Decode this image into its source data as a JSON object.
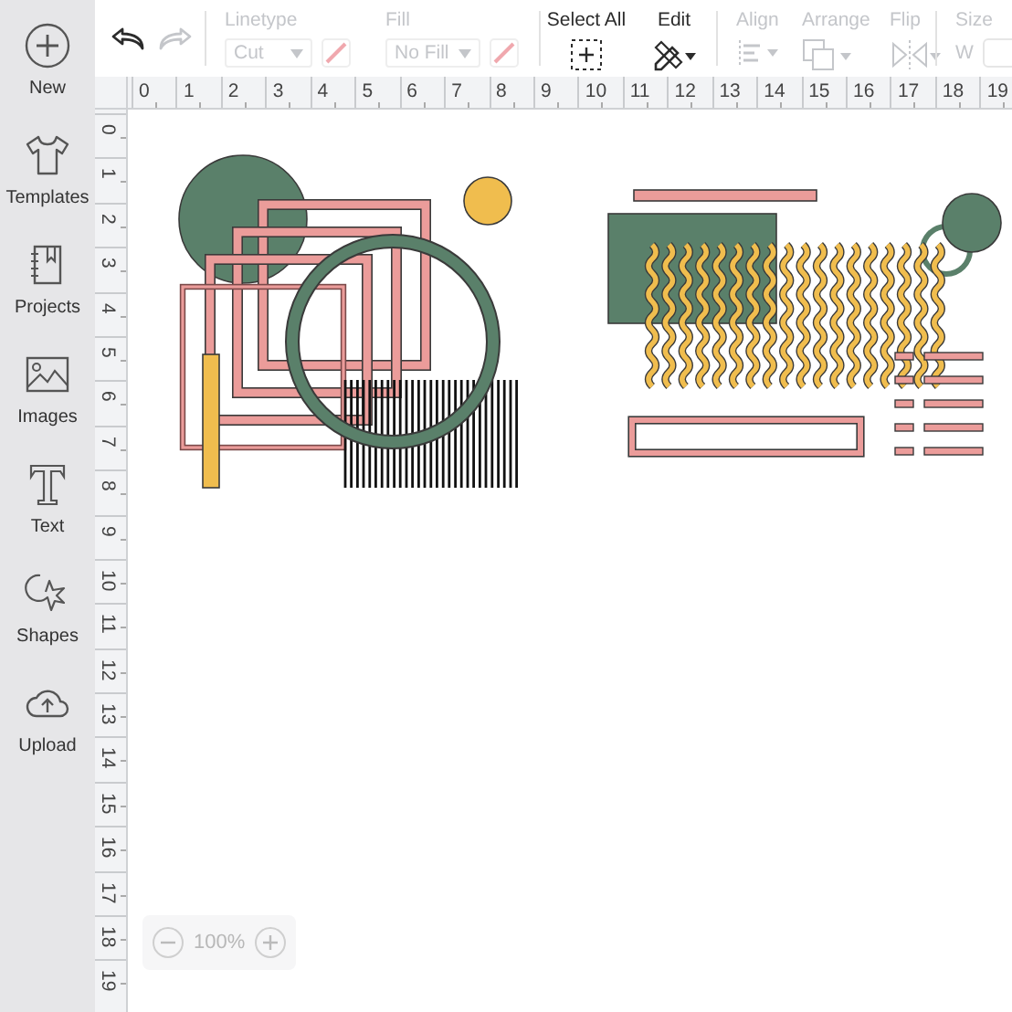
{
  "sidebar": {
    "items": [
      {
        "kind": "new",
        "label": "New"
      },
      {
        "kind": "templates",
        "label": "Templates"
      },
      {
        "kind": "projects",
        "label": "Projects"
      },
      {
        "kind": "images",
        "label": "Images"
      },
      {
        "kind": "text",
        "label": "Text"
      },
      {
        "kind": "shapes",
        "label": "Shapes"
      },
      {
        "kind": "upload",
        "label": "Upload"
      }
    ]
  },
  "toolbar": {
    "undo": {
      "disabled": false
    },
    "redo": {
      "disabled": true
    },
    "groups": [
      {
        "kind": "linetype",
        "label": "Linetype",
        "value": "Cut",
        "disabled": true
      },
      {
        "kind": "fill",
        "label": "Fill",
        "value": "No Fill",
        "disabled": true
      },
      {
        "kind": "select_all",
        "label": "Select All",
        "disabled": false
      },
      {
        "kind": "edit",
        "label": "Edit",
        "disabled": false
      },
      {
        "kind": "align",
        "label": "Align",
        "disabled": true
      },
      {
        "kind": "arrange",
        "label": "Arrange",
        "disabled": true
      },
      {
        "kind": "flip",
        "label": "Flip",
        "disabled": true
      },
      {
        "kind": "size",
        "label": "Size",
        "field_label": "W",
        "disabled": true
      }
    ]
  },
  "rulers": {
    "horizontal": [
      "0",
      "1",
      "2",
      "3",
      "4",
      "5",
      "6",
      "7",
      "8",
      "9",
      "10",
      "11",
      "12",
      "13",
      "14",
      "15",
      "16",
      "17",
      "18",
      "19"
    ],
    "vertical": [
      "0",
      "1",
      "2",
      "3",
      "4",
      "5",
      "6",
      "7",
      "8",
      "9",
      "10",
      "11",
      "12",
      "13",
      "14",
      "15",
      "16",
      "17",
      "18",
      "19"
    ]
  },
  "zoom": {
    "value": "100%"
  }
}
